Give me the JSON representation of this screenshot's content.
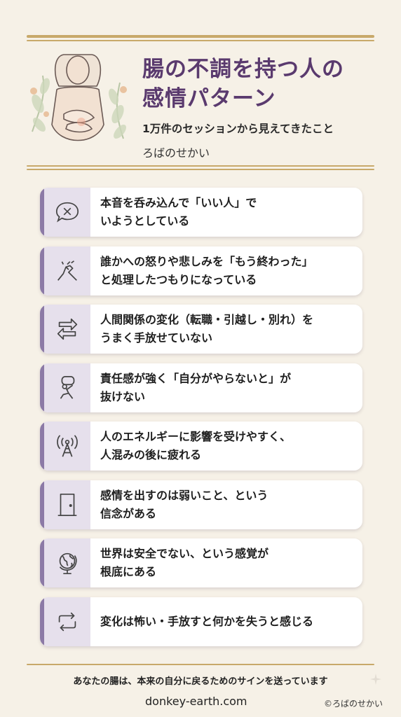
{
  "header": {
    "title_line1": "腸の不調を持つ人の",
    "title_line2": "感情パターン",
    "subtitle": "1万件のセッションから見えてきたこと",
    "author": "ろばのせかい"
  },
  "cards": [
    {
      "icon": "speech-bubble-x-icon",
      "line1": "本音を呑み込んで「いい人」で",
      "line2": "いようとしている"
    },
    {
      "icon": "arm-wrestling-icon",
      "line1": "誰かへの怒りや悲しみを「もう終わった」",
      "line2": "と処理したつもりになっている"
    },
    {
      "icon": "swap-arrows-icon",
      "line1": "人間関係の変化（転職・引越し・別れ）を",
      "line2": "うまく手放せていない"
    },
    {
      "icon": "person-carrying-load-icon",
      "line1": "責任感が強く「自分がやらないと」が",
      "line2": "抜けない"
    },
    {
      "icon": "signal-tower-icon",
      "line1": "人のエネルギーに影響を受けやすく、",
      "line2": "人混みの後に疲れる"
    },
    {
      "icon": "door-icon",
      "line1": "感情を出すのは弱いこと、という",
      "line2": "信念がある"
    },
    {
      "icon": "globe-icon",
      "line1": "世界は安全でない、という感覚が",
      "line2": "根底にある"
    },
    {
      "icon": "repeat-arrows-icon",
      "line1": "変化は怖い・手放すと何かを失うと感じる",
      "line2": ""
    }
  ],
  "footer": {
    "message": "あなたの腸は、本来の自分に戻るためのサインを送っています",
    "site": "donkey-earth.com",
    "copyright": "©ろばのせかい"
  },
  "colors": {
    "background": "#f6f1e7",
    "gold": "#c8a96a",
    "title_purple": "#5a3a6e",
    "accent_purple": "#8c7aa6",
    "icon_bg": "#e6e0ec"
  }
}
